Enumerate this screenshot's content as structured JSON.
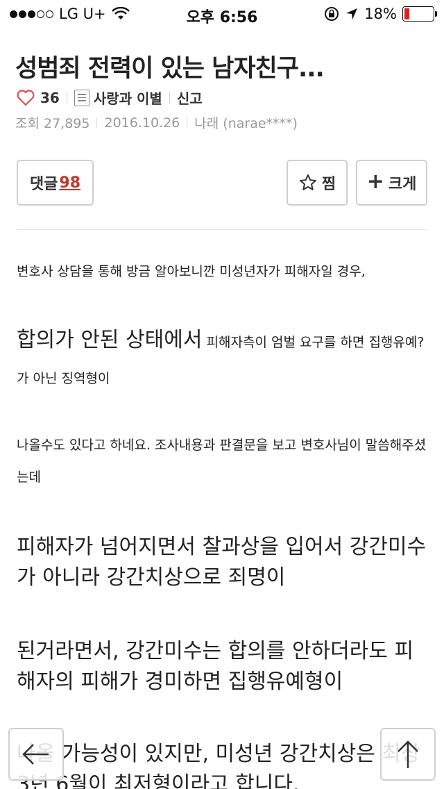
{
  "status_bar": {
    "carrier": "LG U+",
    "time": "오후 6:56",
    "battery": "18%",
    "signal_strength": 3,
    "signal_total": 5,
    "battery_level": 0.18,
    "icons": [
      "wifi-icon",
      "orientation-lock-icon",
      "location-arrow-icon",
      "battery-icon"
    ]
  },
  "post": {
    "title": "성범죄 전력이 있는 남자친구...",
    "likes": "36",
    "category": "사랑과 이별",
    "report": "신고",
    "views": "조회 27,895",
    "date": "2016.10.26",
    "author": "나래 (narae****)"
  },
  "actions": {
    "comments_label": "댓글",
    "comments_count": "98",
    "jjim_label": "찜",
    "bigger_label": "크게"
  },
  "content": {
    "p1": "변호사 상담을 통해 방금 알아보니깐 미성년자가 피해자일 경우,",
    "p2_large": "합의가 안된 상태에서",
    "p2_small": " 피해자측이 엄벌 요구를 하면 집행유예?가 아닌 징역형이",
    "p3": "나올수도 있다고 하네요. 조사내용과 판결문을 보고 변호사님이 말씀해주셨는데",
    "p4": "피해자가 넘어지면서 찰과상을 입어서 강간미수가 아니라 강간치상으로 죄명이",
    "p5": "된거라면서, 강간미수는 합의를 안하더라도 피해자의 피해가 경미하면 집행유예형이",
    "p6": "나올 가능성이 있지만, 미성년 강간치상은 최상 3년 6월이 최저형이라고 합니다."
  },
  "colors": {
    "accent_red": "#c0392b",
    "heart": "#d9534f",
    "border": "#cfcfcf"
  }
}
